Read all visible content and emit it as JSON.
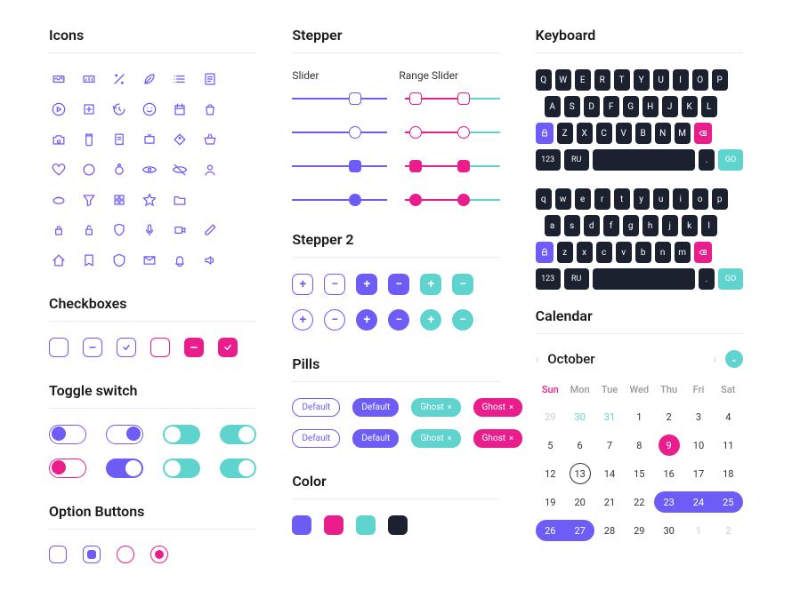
{
  "sections": {
    "icons": "Icons",
    "checkboxes": "Checkboxes",
    "toggle": "Toggle switch",
    "option": "Option Buttons",
    "stepper": "Stepper",
    "stepper2": "Stepper 2",
    "pills": "Pills",
    "color": "Color",
    "keyboard": "Keyboard",
    "calendar": "Calendar"
  },
  "icon_names": [
    "chart-wave",
    "chart-bar",
    "percent",
    "leaf",
    "list",
    "note",
    "play",
    "add-square",
    "clock-back",
    "emoji",
    "calendar",
    "bag",
    "camera",
    "jar",
    "receipt",
    "tv",
    "tag",
    "basket",
    "heart",
    "circle",
    "ring",
    "eye",
    "eye-off",
    "user",
    "plate",
    "funnel",
    "grid",
    "star",
    "folder",
    "blank",
    "lock",
    "lock-open",
    "shield",
    "mic",
    "video",
    "pencil",
    "home",
    "bookmark",
    "badge",
    "mail",
    "bell",
    "speaker"
  ],
  "slider_labels": {
    "single": "Slider",
    "range": "Range Slider"
  },
  "pills": {
    "default": "Default",
    "ghost": "Ghost"
  },
  "stepper_symbols": {
    "plus": "+",
    "minus": "−"
  },
  "colors": {
    "purple": "#6d5df6",
    "pink": "#e91e8c",
    "teal": "#5fd4cf",
    "dark": "#1c2130"
  },
  "keyboard": {
    "upper": [
      [
        "Q",
        "W",
        "E",
        "R",
        "T",
        "Y",
        "U",
        "I",
        "O",
        "P"
      ],
      [
        "A",
        "S",
        "D",
        "F",
        "G",
        "H",
        "J",
        "K",
        "L"
      ],
      [
        "shift",
        "Z",
        "X",
        "C",
        "V",
        "B",
        "N",
        "M",
        "back"
      ],
      [
        "123",
        "RU",
        "space",
        ".",
        "GO"
      ]
    ],
    "lower": [
      [
        "q",
        "w",
        "e",
        "r",
        "t",
        "y",
        "u",
        "i",
        "o",
        "p"
      ],
      [
        "a",
        "s",
        "d",
        "f",
        "g",
        "h",
        "j",
        "k",
        "l"
      ],
      [
        "shift",
        "z",
        "x",
        "c",
        "v",
        "b",
        "n",
        "m",
        "back"
      ],
      [
        "123",
        "RU",
        "space",
        ".",
        "GO"
      ]
    ],
    "mode_key": "123",
    "lang_key": "RU",
    "go_key": "GO",
    "dot_key": "."
  },
  "calendar": {
    "month": "October",
    "dow": [
      "Sun",
      "Mon",
      "Tue",
      "Wed",
      "Thu",
      "Fri",
      "Sat"
    ],
    "days": [
      {
        "n": 29,
        "cls": "muted"
      },
      {
        "n": 30,
        "cls": "teal"
      },
      {
        "n": 31,
        "cls": "teal"
      },
      {
        "n": 1
      },
      {
        "n": 2
      },
      {
        "n": 3
      },
      {
        "n": 4
      },
      {
        "n": 5
      },
      {
        "n": 6
      },
      {
        "n": 7
      },
      {
        "n": 8
      },
      {
        "n": 9,
        "cls": "sel-pink"
      },
      {
        "n": 10
      },
      {
        "n": 11
      },
      {
        "n": 12
      },
      {
        "n": 13,
        "cls": "ring"
      },
      {
        "n": 14
      },
      {
        "n": 15
      },
      {
        "n": 16
      },
      {
        "n": 17
      },
      {
        "n": 18
      },
      {
        "n": 19
      },
      {
        "n": 20
      },
      {
        "n": 21
      },
      {
        "n": 22
      },
      {
        "n": 23,
        "cls": "range start"
      },
      {
        "n": 24,
        "cls": "range"
      },
      {
        "n": 25,
        "cls": "range end"
      },
      {
        "n": 26,
        "cls": "range start"
      },
      {
        "n": 27,
        "cls": "range end"
      },
      {
        "n": 28
      },
      {
        "n": 29
      },
      {
        "n": 30
      },
      {
        "n": 1,
        "cls": "muted"
      },
      {
        "n": 2,
        "cls": "muted"
      }
    ]
  }
}
